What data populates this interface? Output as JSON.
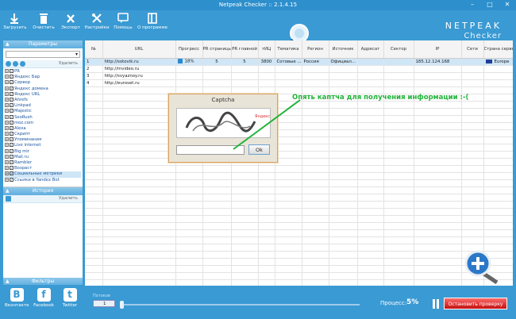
{
  "window": {
    "title": "Netpeak Checker :: 2.1.4.15"
  },
  "toolbar": {
    "items": [
      {
        "label": "Загрузить"
      },
      {
        "label": "Очистить"
      },
      {
        "label": "Экспорт"
      },
      {
        "label": "Настройки"
      },
      {
        "label": "Помощь"
      },
      {
        "label": "О программе"
      }
    ],
    "brand_name": "NETPEAK",
    "brand_sub": "Checker"
  },
  "params": {
    "title": "Параметры",
    "delete_label": "Удалить",
    "tree": [
      "PR",
      "Яндекс Бар",
      "Сервер",
      "Яндекс домена",
      "Яндекс URL",
      "Ahrefs",
      "Linkpad",
      "Majestic",
      "SeoRush",
      "moz.com",
      "Alexa",
      "Скрипт",
      "Упоминания",
      "Live internet",
      "Big mir",
      "Mail.ru",
      "Rambler",
      "Возраст",
      "Социальные метрики",
      "Ссылки в Yandex Bot"
    ]
  },
  "history": {
    "title": "История",
    "delete_label": "Удалить"
  },
  "filters": {
    "title": "Фильтры"
  },
  "social": [
    {
      "logo": "B",
      "label": "Вконтакте"
    },
    {
      "logo": "f",
      "label": "Facebook"
    },
    {
      "logo": "t",
      "label": "Twitter"
    }
  ],
  "table": {
    "columns": [
      "№",
      "URL",
      "Прогресс",
      "PR страницы",
      "PR главной",
      "тИЦ",
      "Тематика",
      "Регион",
      "Источник",
      "Адресат",
      "Сектор",
      "IP",
      "Сети",
      "Страна сервера"
    ],
    "rows": [
      {
        "n": "1",
        "url": "http://sotovik.ru",
        "progress": "18%",
        "pr_page": "5",
        "pr_main": "5",
        "tic": "3800",
        "topic": "Сотовые ...",
        "region": "Россия",
        "source": "Официал...",
        "addressee": "",
        "sector": "",
        "ip": "185.12.124.168",
        "net": "",
        "country": "Europe"
      },
      {
        "n": "2",
        "url": "http://mvideo.ru"
      },
      {
        "n": "3",
        "url": "http://svyaznoy.ru"
      },
      {
        "n": "4",
        "url": "http://euroset.ru"
      }
    ]
  },
  "captcha": {
    "title": "Captcha",
    "yandex_word": "Яндекс",
    "ok_label": "Ok",
    "input_value": ""
  },
  "annotation": "Опять каптча для получения информации :-(",
  "bottom": {
    "threads_label": "Потоков",
    "threads_value": "1",
    "process_label": "Процесс:",
    "process_value": "5%",
    "stop_label": "Остановить проверку"
  },
  "colors": {
    "accent": "#3a9ad3",
    "annotation": "#22b33a",
    "stop": "#d41c1c"
  }
}
